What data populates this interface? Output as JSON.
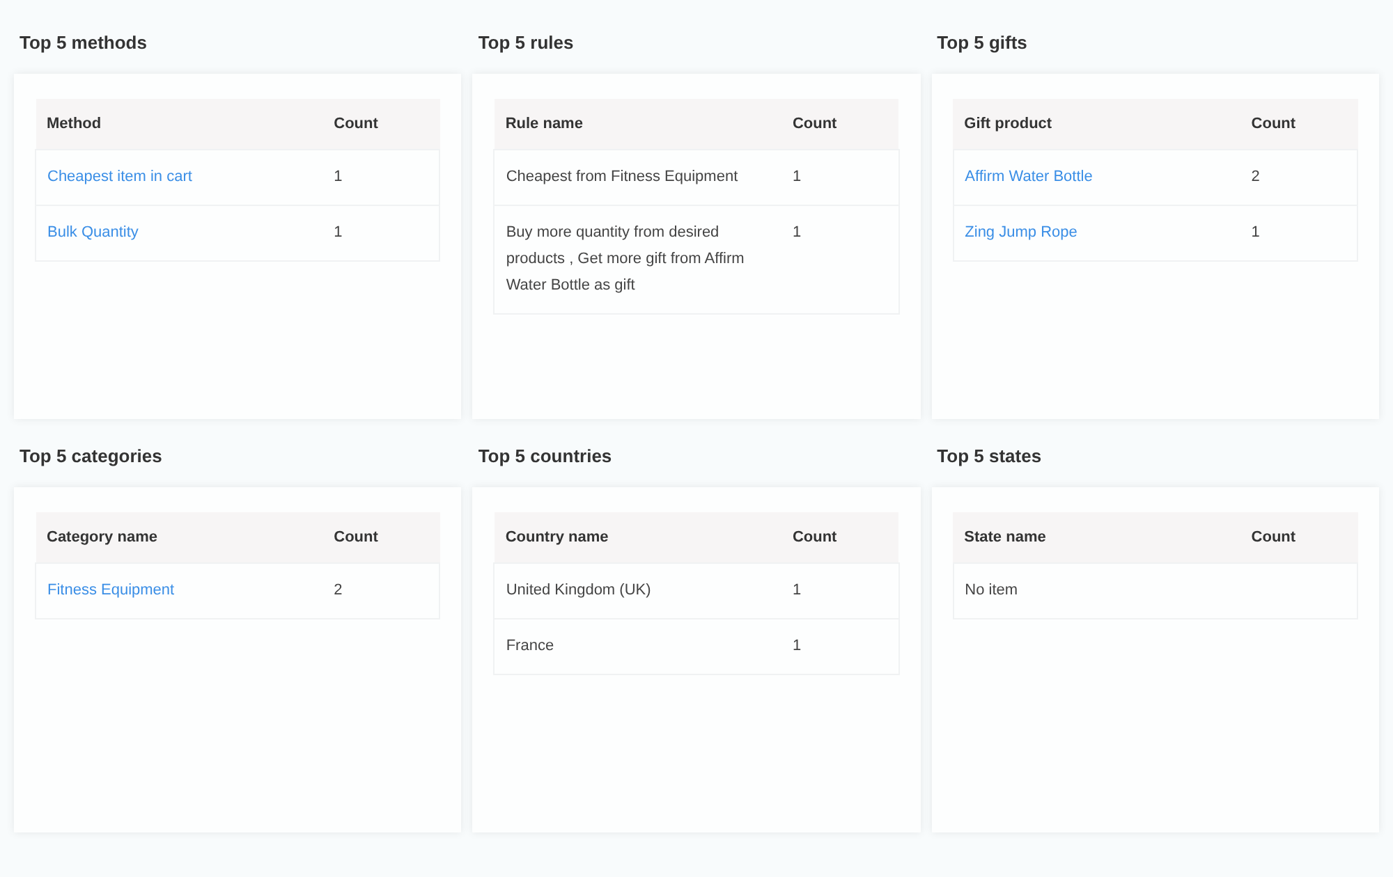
{
  "panels": [
    {
      "title": "Top 5 methods",
      "columns": [
        "Method",
        "Count"
      ],
      "rows": [
        {
          "cells": [
            {
              "text": "Cheapest item in cart",
              "kind": "link"
            },
            {
              "text": "1",
              "kind": "text"
            }
          ]
        },
        {
          "cells": [
            {
              "text": "Bulk Quantity",
              "kind": "link"
            },
            {
              "text": "1",
              "kind": "text"
            }
          ]
        }
      ]
    },
    {
      "title": "Top 5 rules",
      "columns": [
        "Rule name",
        "Count"
      ],
      "rows": [
        {
          "cells": [
            {
              "text": "Cheapest from Fitness Equipment",
              "kind": "text"
            },
            {
              "text": "1",
              "kind": "text"
            }
          ]
        },
        {
          "cells": [
            {
              "text": "Buy more quantity from desired products , Get more gift from Affirm Water Bottle as gift",
              "kind": "text"
            },
            {
              "text": "1",
              "kind": "text"
            }
          ]
        }
      ]
    },
    {
      "title": "Top 5 gifts",
      "columns": [
        "Gift product",
        "Count"
      ],
      "rows": [
        {
          "cells": [
            {
              "text": "Affirm Water Bottle",
              "kind": "link"
            },
            {
              "text": "2",
              "kind": "text"
            }
          ]
        },
        {
          "cells": [
            {
              "text": "Zing Jump Rope",
              "kind": "link"
            },
            {
              "text": "1",
              "kind": "text"
            }
          ]
        }
      ]
    },
    {
      "title": "Top 5 categories",
      "columns": [
        "Category name",
        "Count"
      ],
      "rows": [
        {
          "cells": [
            {
              "text": "Fitness Equipment",
              "kind": "link"
            },
            {
              "text": "2",
              "kind": "text"
            }
          ]
        }
      ]
    },
    {
      "title": "Top 5 countries",
      "columns": [
        "Country name",
        "Count"
      ],
      "rows": [
        {
          "cells": [
            {
              "text": "United Kingdom (UK)",
              "kind": "text"
            },
            {
              "text": "1",
              "kind": "text"
            }
          ]
        },
        {
          "cells": [
            {
              "text": "France",
              "kind": "text"
            },
            {
              "text": "1",
              "kind": "text"
            }
          ]
        }
      ]
    },
    {
      "title": "Top 5 states",
      "columns": [
        "State name",
        "Count"
      ],
      "rows": [
        {
          "cells": [
            {
              "text": "No item",
              "kind": "text"
            }
          ]
        }
      ]
    }
  ]
}
